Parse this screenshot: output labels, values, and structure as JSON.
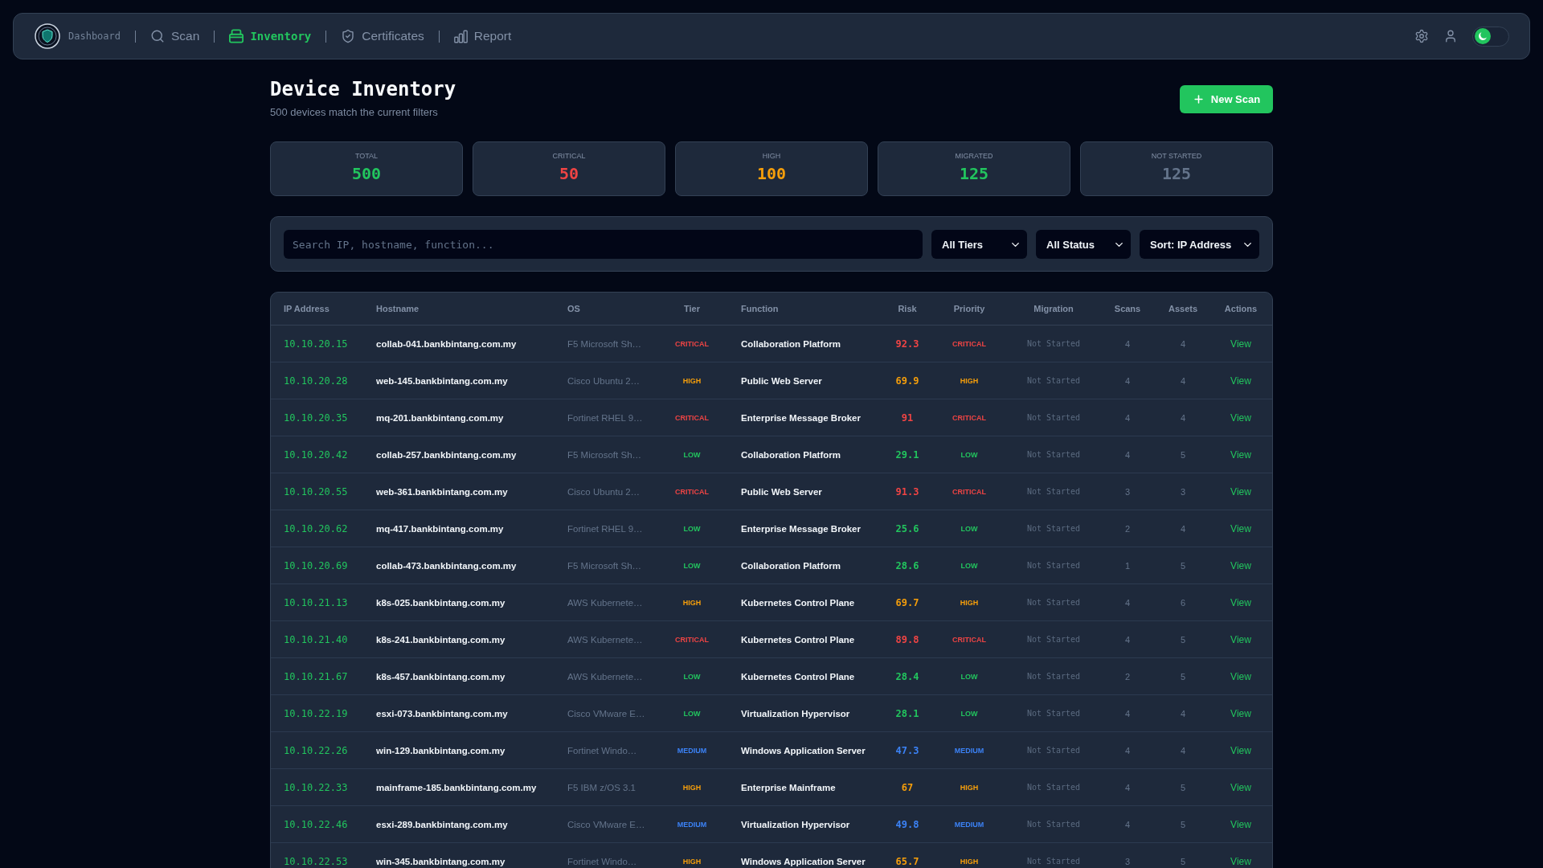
{
  "nav": {
    "brand": "Dashboard",
    "items": [
      {
        "label": "Scan",
        "selected": false
      },
      {
        "label": "Inventory",
        "selected": true
      },
      {
        "label": "Certificates",
        "selected": false
      },
      {
        "label": "Report",
        "selected": false
      }
    ],
    "theme_toggle": {
      "light_mode": false
    }
  },
  "header": {
    "title": "Device Inventory",
    "subtitle": "500 devices match the current filters",
    "new_scan_button": "New Scan"
  },
  "stats": [
    {
      "label": "TOTAL",
      "value": "500",
      "color": "#22c55e"
    },
    {
      "label": "CRITICAL",
      "value": "50",
      "color": "#ef4444"
    },
    {
      "label": "HIGH",
      "value": "100",
      "color": "#f59e0b"
    },
    {
      "label": "MIGRATED",
      "value": "125",
      "color": "#22c55e"
    },
    {
      "label": "NOT STARTED",
      "value": "125",
      "color": "#64748b"
    }
  ],
  "filters": {
    "search": {
      "placeholder": "Search IP, hostname, function..."
    },
    "dropdowns": [
      "All Tiers",
      "All Status",
      "Sort: IP Address"
    ]
  },
  "table": {
    "columns": [
      "IP Address",
      "Hostname",
      "OS",
      "Tier",
      "Function",
      "Risk",
      "Priority",
      "Migration",
      "Scans",
      "Assets",
      "Actions"
    ],
    "rows": [
      {
        "ip": "10.10.20.15",
        "hostname": "collab-041.bankbintang.com.my",
        "os": "F5 Microsoft Sh…",
        "tier": {
          "label": "CRITICAL",
          "kind": "critical"
        },
        "function": "Collaboration Platform",
        "risk": {
          "value": "92.3",
          "kind": "critical"
        },
        "priority": {
          "label": "CRITICAL",
          "kind": "critical"
        },
        "migration": "Not Started",
        "scans": "4",
        "assets": "4",
        "action": "View"
      },
      {
        "ip": "10.10.20.28",
        "hostname": "web-145.bankbintang.com.my",
        "os": "Cisco Ubuntu 2…",
        "tier": {
          "label": "HIGH",
          "kind": "high"
        },
        "function": "Public Web Server",
        "risk": {
          "value": "69.9",
          "kind": "high"
        },
        "priority": {
          "label": "HIGH",
          "kind": "high"
        },
        "migration": "Not Started",
        "scans": "4",
        "assets": "4",
        "action": "View"
      },
      {
        "ip": "10.10.20.35",
        "hostname": "mq-201.bankbintang.com.my",
        "os": "Fortinet RHEL 9…",
        "tier": {
          "label": "CRITICAL",
          "kind": "critical"
        },
        "function": "Enterprise Message Broker",
        "risk": {
          "value": "91",
          "kind": "critical"
        },
        "priority": {
          "label": "CRITICAL",
          "kind": "critical"
        },
        "migration": "Not Started",
        "scans": "4",
        "assets": "4",
        "action": "View"
      },
      {
        "ip": "10.10.20.42",
        "hostname": "collab-257.bankbintang.com.my",
        "os": "F5 Microsoft Sh…",
        "tier": {
          "label": "LOW",
          "kind": "low"
        },
        "function": "Collaboration Platform",
        "risk": {
          "value": "29.1",
          "kind": "low"
        },
        "priority": {
          "label": "LOW",
          "kind": "low"
        },
        "migration": "Not Started",
        "scans": "4",
        "assets": "5",
        "action": "View"
      },
      {
        "ip": "10.10.20.55",
        "hostname": "web-361.bankbintang.com.my",
        "os": "Cisco Ubuntu 2…",
        "tier": {
          "label": "CRITICAL",
          "kind": "critical"
        },
        "function": "Public Web Server",
        "risk": {
          "value": "91.3",
          "kind": "critical"
        },
        "priority": {
          "label": "CRITICAL",
          "kind": "critical"
        },
        "migration": "Not Started",
        "scans": "3",
        "assets": "3",
        "action": "View"
      },
      {
        "ip": "10.10.20.62",
        "hostname": "mq-417.bankbintang.com.my",
        "os": "Fortinet RHEL 9…",
        "tier": {
          "label": "LOW",
          "kind": "low"
        },
        "function": "Enterprise Message Broker",
        "risk": {
          "value": "25.6",
          "kind": "low"
        },
        "priority": {
          "label": "LOW",
          "kind": "low"
        },
        "migration": "Not Started",
        "scans": "2",
        "assets": "4",
        "action": "View"
      },
      {
        "ip": "10.10.20.69",
        "hostname": "collab-473.bankbintang.com.my",
        "os": "F5 Microsoft Sh…",
        "tier": {
          "label": "LOW",
          "kind": "low"
        },
        "function": "Collaboration Platform",
        "risk": {
          "value": "28.6",
          "kind": "low"
        },
        "priority": {
          "label": "LOW",
          "kind": "low"
        },
        "migration": "Not Started",
        "scans": "1",
        "assets": "5",
        "action": "View"
      },
      {
        "ip": "10.10.21.13",
        "hostname": "k8s-025.bankbintang.com.my",
        "os": "AWS Kubernete…",
        "tier": {
          "label": "HIGH",
          "kind": "high"
        },
        "function": "Kubernetes Control Plane",
        "risk": {
          "value": "69.7",
          "kind": "high"
        },
        "priority": {
          "label": "HIGH",
          "kind": "high"
        },
        "migration": "Not Started",
        "scans": "4",
        "assets": "6",
        "action": "View"
      },
      {
        "ip": "10.10.21.40",
        "hostname": "k8s-241.bankbintang.com.my",
        "os": "AWS Kubernete…",
        "tier": {
          "label": "CRITICAL",
          "kind": "critical"
        },
        "function": "Kubernetes Control Plane",
        "risk": {
          "value": "89.8",
          "kind": "critical"
        },
        "priority": {
          "label": "CRITICAL",
          "kind": "critical"
        },
        "migration": "Not Started",
        "scans": "4",
        "assets": "5",
        "action": "View"
      },
      {
        "ip": "10.10.21.67",
        "hostname": "k8s-457.bankbintang.com.my",
        "os": "AWS Kubernete…",
        "tier": {
          "label": "LOW",
          "kind": "low"
        },
        "function": "Kubernetes Control Plane",
        "risk": {
          "value": "28.4",
          "kind": "low"
        },
        "priority": {
          "label": "LOW",
          "kind": "low"
        },
        "migration": "Not Started",
        "scans": "2",
        "assets": "5",
        "action": "View"
      },
      {
        "ip": "10.10.22.19",
        "hostname": "esxi-073.bankbintang.com.my",
        "os": "Cisco VMware E…",
        "tier": {
          "label": "LOW",
          "kind": "low"
        },
        "function": "Virtualization Hypervisor",
        "risk": {
          "value": "28.1",
          "kind": "low"
        },
        "priority": {
          "label": "LOW",
          "kind": "low"
        },
        "migration": "Not Started",
        "scans": "4",
        "assets": "4",
        "action": "View"
      },
      {
        "ip": "10.10.22.26",
        "hostname": "win-129.bankbintang.com.my",
        "os": "Fortinet Windo…",
        "tier": {
          "label": "MEDIUM",
          "kind": "medium"
        },
        "function": "Windows Application Server",
        "risk": {
          "value": "47.3",
          "kind": "medium"
        },
        "priority": {
          "label": "MEDIUM",
          "kind": "medium"
        },
        "migration": "Not Started",
        "scans": "4",
        "assets": "4",
        "action": "View"
      },
      {
        "ip": "10.10.22.33",
        "hostname": "mainframe-185.bankbintang.com.my",
        "os": "F5 IBM z/OS 3.1",
        "tier": {
          "label": "HIGH",
          "kind": "high"
        },
        "function": "Enterprise Mainframe",
        "risk": {
          "value": "67",
          "kind": "high"
        },
        "priority": {
          "label": "HIGH",
          "kind": "high"
        },
        "migration": "Not Started",
        "scans": "4",
        "assets": "5",
        "action": "View"
      },
      {
        "ip": "10.10.22.46",
        "hostname": "esxi-289.bankbintang.com.my",
        "os": "Cisco VMware E…",
        "tier": {
          "label": "MEDIUM",
          "kind": "medium"
        },
        "function": "Virtualization Hypervisor",
        "risk": {
          "value": "49.8",
          "kind": "medium"
        },
        "priority": {
          "label": "MEDIUM",
          "kind": "medium"
        },
        "migration": "Not Started",
        "scans": "4",
        "assets": "5",
        "action": "View"
      },
      {
        "ip": "10.10.22.53",
        "hostname": "win-345.bankbintang.com.my",
        "os": "Fortinet Windo…",
        "tier": {
          "label": "HIGH",
          "kind": "high"
        },
        "function": "Windows Application Server",
        "risk": {
          "value": "65.7",
          "kind": "high"
        },
        "priority": {
          "label": "HIGH",
          "kind": "high"
        },
        "migration": "Not Started",
        "scans": "3",
        "assets": "5",
        "action": "View"
      }
    ]
  }
}
